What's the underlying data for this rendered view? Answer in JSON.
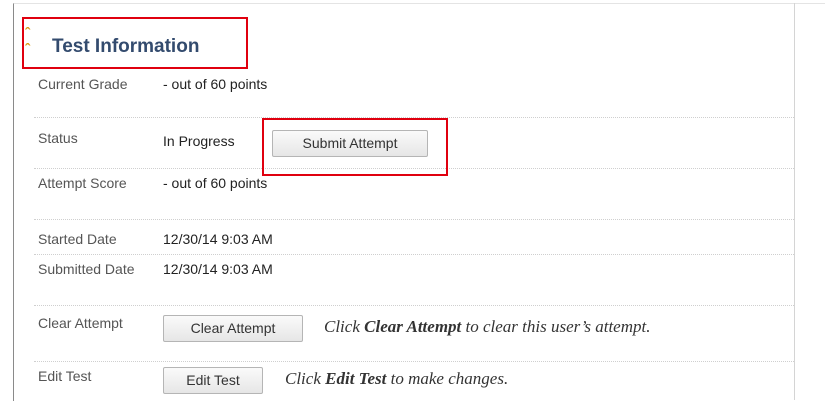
{
  "section": {
    "title": "Test Information",
    "toggle_icon": "double-chevron-up-icon"
  },
  "rows": {
    "current_grade": {
      "label": "Current Grade",
      "value": "- out of 60 points"
    },
    "status": {
      "label": "Status",
      "value": "In Progress",
      "button": "Submit Attempt"
    },
    "attempt_score": {
      "label": "Attempt Score",
      "value": "- out of 60 points"
    },
    "started_date": {
      "label": "Started Date",
      "value": "12/30/14 9:03 AM"
    },
    "submitted_date": {
      "label": "Submitted Date",
      "value": "12/30/14 9:03 AM"
    },
    "clear_attempt": {
      "label": "Clear Attempt",
      "button": "Clear Attempt",
      "hint_prefix": "Click ",
      "hint_bold": "Clear Attempt",
      "hint_suffix": " to clear this user’s attempt."
    },
    "edit_test": {
      "label": "Edit Test",
      "button": "Edit Test",
      "hint_prefix": "Click ",
      "hint_bold": "Edit Test",
      "hint_suffix": " to make changes."
    }
  },
  "colors": {
    "highlight": "#e0000f",
    "title": "#334b6e",
    "chevron": "#d99a11"
  }
}
